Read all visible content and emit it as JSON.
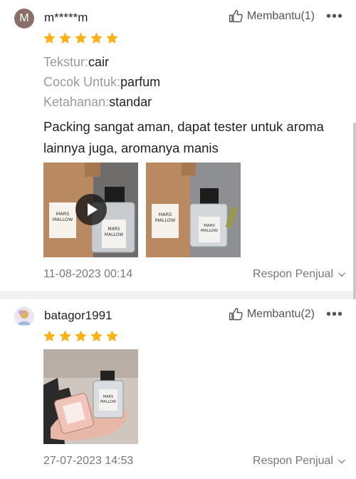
{
  "reviews": [
    {
      "username": "m*****m",
      "avatar_letter": "M",
      "helpful_label": "Membantu(1)",
      "rating": 5,
      "attributes": [
        {
          "label": "Tekstur:",
          "value": "cair"
        },
        {
          "label": "Cocok Untuk:",
          "value": "parfum"
        },
        {
          "label": "Ketahanan:",
          "value": "standar"
        }
      ],
      "comment": "Packing sangat aman, dapat tester untuk aroma lainnya juga, aromanya manis",
      "photos": [
        {
          "type": "video",
          "box_text": [
            "MARS",
            "MALLOW"
          ],
          "bottle_text": [
            "MARS",
            "MALLOW"
          ]
        },
        {
          "type": "image",
          "box_text": [
            "MARS",
            "MALLOW"
          ],
          "bottle_text": [
            "MARS",
            "MALLOW"
          ]
        }
      ],
      "date": "11-08-2023 00:14",
      "seller_response_label": "Respon Penjual"
    },
    {
      "username": "batagor1991",
      "helpful_label": "Membantu(2)",
      "rating": 5,
      "photos": [
        {
          "type": "image",
          "bottle_text": [
            "MARS",
            "MALLOW"
          ]
        }
      ],
      "date": "27-07-2023 14:53",
      "seller_response_label": "Respon Penjual"
    }
  ],
  "colors": {
    "star": "#fbb117",
    "muted": "#9a9a9a",
    "text": "#222222",
    "separator": "#f2f2f2"
  },
  "icons": {
    "helpful": "thumbs-up-icon",
    "more": "more-dots-icon",
    "expand": "chevron-down-icon",
    "play": "play-icon",
    "rating": "star-icon"
  }
}
